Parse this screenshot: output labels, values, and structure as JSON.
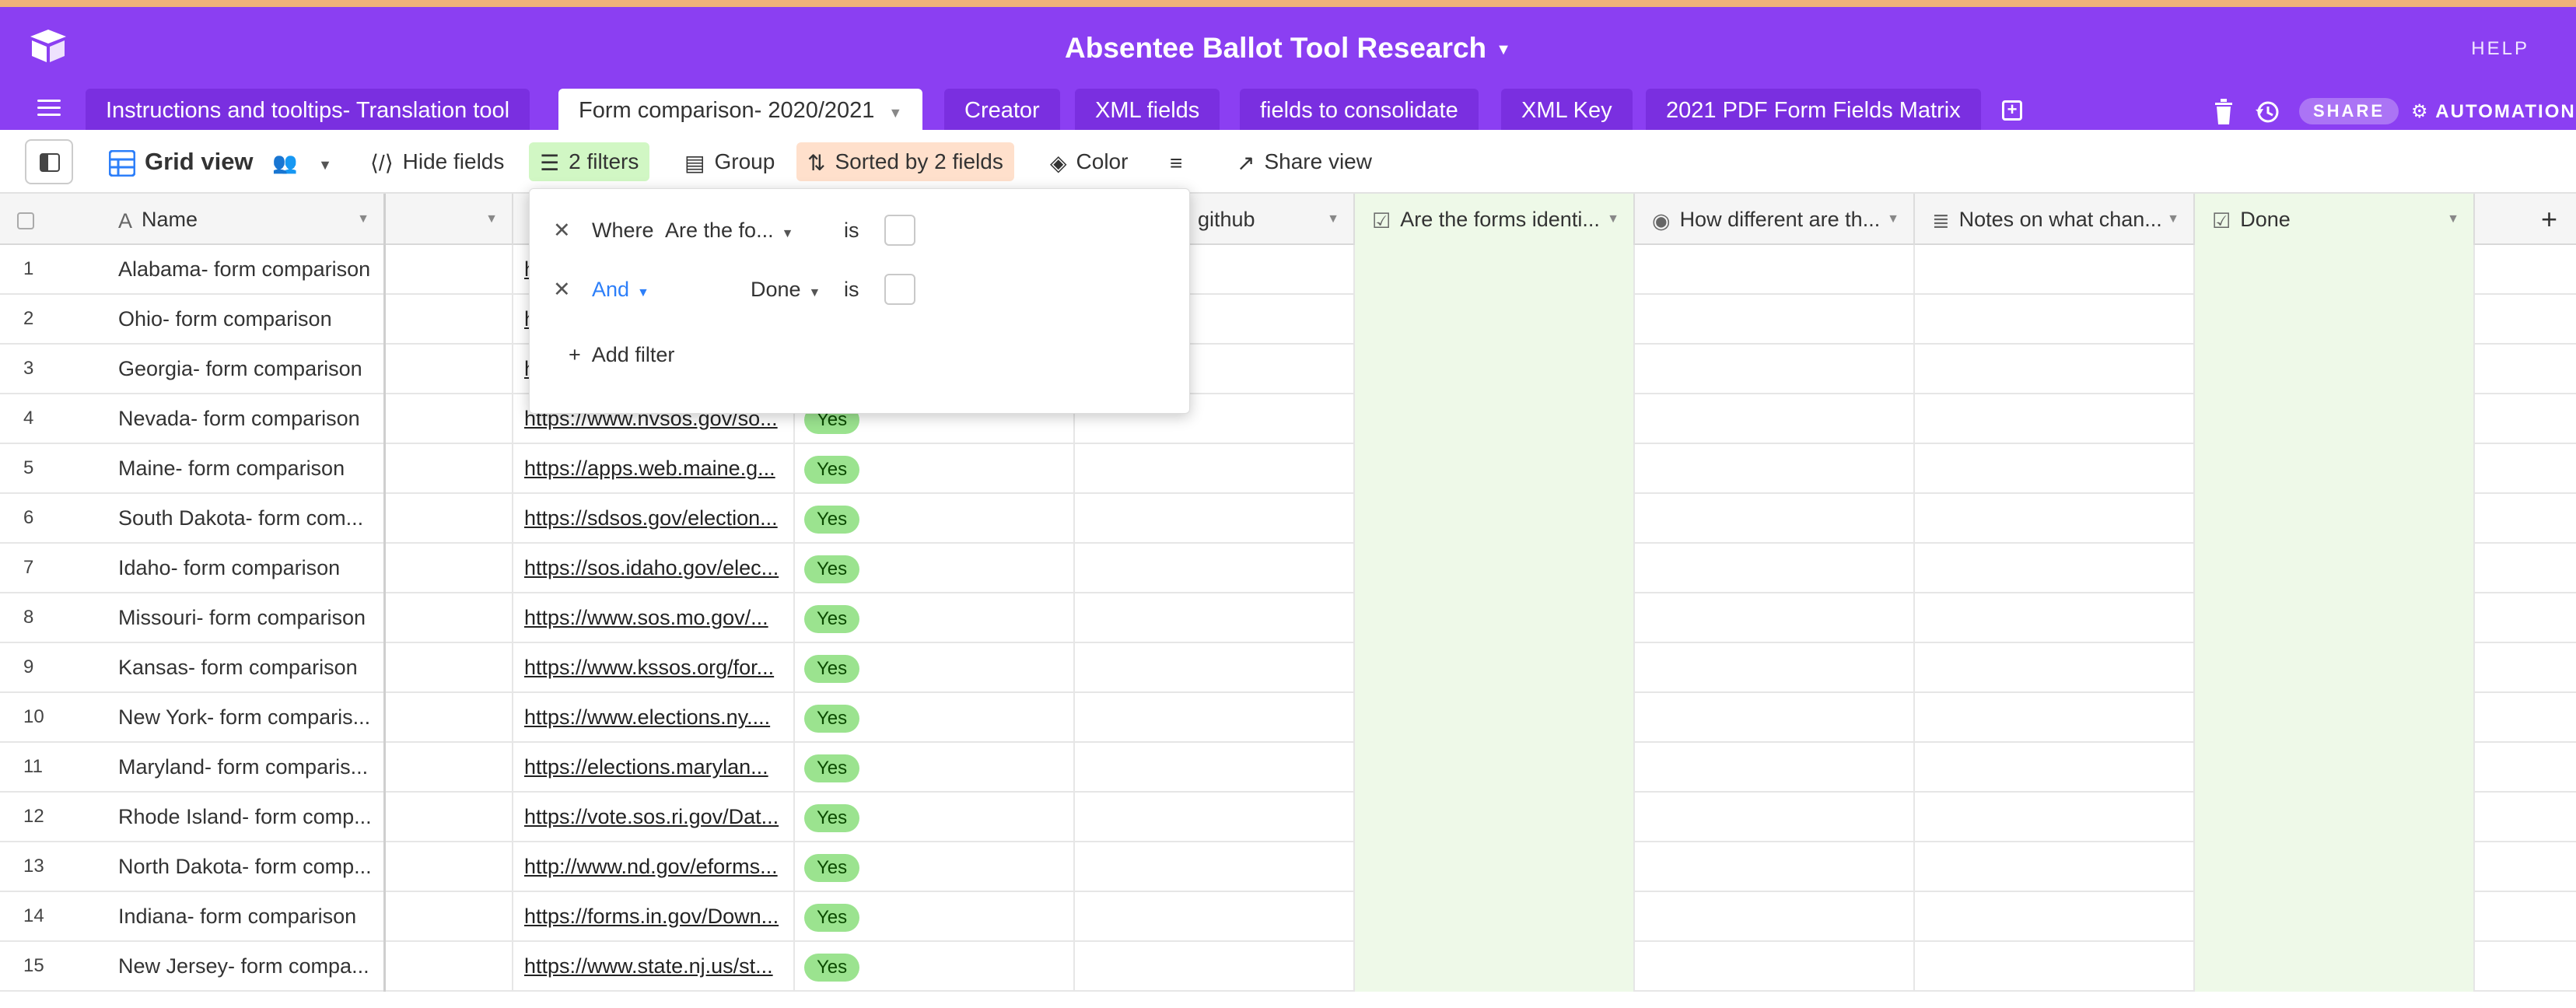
{
  "app": {
    "base_title": "Absentee Ballot Tool Research",
    "help_label": "HELP",
    "share_label": "SHARE",
    "automations_label": "AUTOMATIONS",
    "accent_color": "#8b3ff2"
  },
  "tabs": [
    {
      "label": "Instructions and tooltips- Translation tool",
      "active": false
    },
    {
      "label": "Form comparison- 2020/2021",
      "active": true
    },
    {
      "label": "Creator",
      "active": false
    },
    {
      "label": "XML fields",
      "active": false
    },
    {
      "label": "fields to consolidate",
      "active": false
    },
    {
      "label": "XML Key",
      "active": false
    },
    {
      "label": "2021 PDF Form Fields Matrix",
      "active": false
    }
  ],
  "toolbar": {
    "view_name": "Grid view",
    "hide_fields": "Hide fields",
    "filters": "2 filters",
    "group": "Group",
    "sorted": "Sorted by 2 fields",
    "color": "Color",
    "share_view": "Share view"
  },
  "columns": {
    "name": "Name",
    "github": "github",
    "identical": "Are the forms identi...",
    "how_different": "How different are th...",
    "notes": "Notes on what chan...",
    "done": "Done"
  },
  "filter_popover": {
    "where": "Where",
    "field1": "Are the fo...",
    "is1": "is",
    "conjunction": "And",
    "field2": "Done",
    "is2": "is",
    "add_filter": "Add filter"
  },
  "rows": [
    {
      "num": "1",
      "name": "Alabama- form comparison",
      "link": "h",
      "yes": ""
    },
    {
      "num": "2",
      "name": "Ohio- form comparison",
      "link": "h",
      "yes": ""
    },
    {
      "num": "3",
      "name": "Georgia- form comparison",
      "link": "h",
      "yes": ""
    },
    {
      "num": "4",
      "name": "Nevada- form comparison",
      "link": "https://www.nvsos.gov/so...",
      "yes": "Yes"
    },
    {
      "num": "5",
      "name": "Maine- form comparison",
      "link": "https://apps.web.maine.g...",
      "yes": "Yes"
    },
    {
      "num": "6",
      "name": "South Dakota- form com...",
      "link": "https://sdsos.gov/election...",
      "yes": "Yes"
    },
    {
      "num": "7",
      "name": "Idaho- form comparison",
      "link": "https://sos.idaho.gov/elec...",
      "yes": "Yes"
    },
    {
      "num": "8",
      "name": "Missouri- form comparison",
      "link": "https://www.sos.mo.gov/...",
      "yes": "Yes"
    },
    {
      "num": "9",
      "name": "Kansas- form comparison",
      "link": "https://www.kssos.org/for...",
      "yes": "Yes"
    },
    {
      "num": "10",
      "name": "New York- form comparis...",
      "link": "https://www.elections.ny....",
      "yes": "Yes"
    },
    {
      "num": "11",
      "name": "Maryland- form comparis...",
      "link": "https://elections.marylan...",
      "yes": "Yes"
    },
    {
      "num": "12",
      "name": "Rhode Island- form comp...",
      "link": "https://vote.sos.ri.gov/Dat...",
      "yes": "Yes"
    },
    {
      "num": "13",
      "name": "North Dakota- form comp...",
      "link": "http://www.nd.gov/eforms...",
      "yes": "Yes"
    },
    {
      "num": "14",
      "name": "Indiana- form comparison",
      "link": "https://forms.in.gov/Down...",
      "yes": "Yes"
    },
    {
      "num": "15",
      "name": "New Jersey- form compa...",
      "link": "https://www.state.nj.us/st...",
      "yes": "Yes"
    }
  ]
}
